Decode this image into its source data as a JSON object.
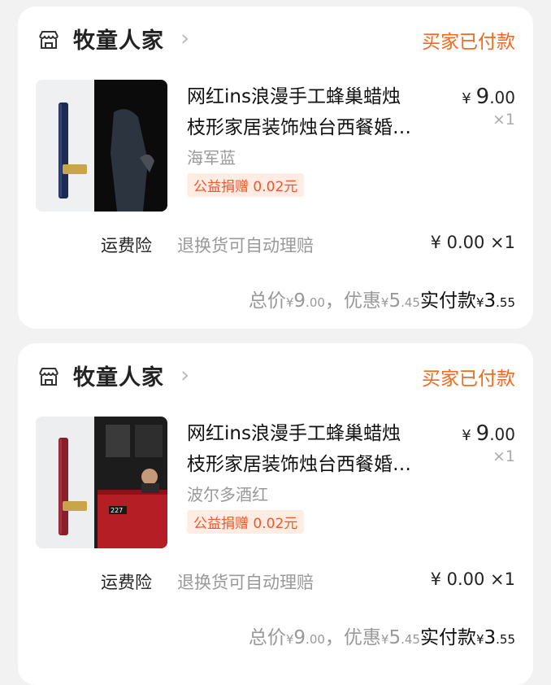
{
  "orders": [
    {
      "store": "牧童人家",
      "status": "买家已付款",
      "title_line1": "网红ins浪漫手工蜂巢蜡烛",
      "title_line2": "枝形家居装饰烛台西餐婚…",
      "price_int": "9",
      "price_dec": ".00",
      "currency": "¥",
      "qty": "×1",
      "variant": "海军蓝",
      "charity": "公益捐赠 0.02元",
      "insurance_label": "运费险",
      "insurance_desc": "退换货可自动理赔",
      "insurance_price": "¥ 0.00 ×1",
      "total_label": "总价",
      "total_int": "9",
      "total_dec": ".00",
      "discount_label": "，优惠",
      "discount_int": "5",
      "discount_dec": ".45",
      "paid_label": "实付款",
      "paid_int": "3",
      "paid_dec": ".55",
      "candle_color": "#1d2a52"
    },
    {
      "store": "牧童人家",
      "status": "买家已付款",
      "title_line1": "网红ins浪漫手工蜂巢蜡烛",
      "title_line2": "枝形家居装饰烛台西餐婚…",
      "price_int": "9",
      "price_dec": ".00",
      "currency": "¥",
      "qty": "×1",
      "variant": "波尔多酒红",
      "charity": "公益捐赠 0.02元",
      "insurance_label": "运费险",
      "insurance_desc": "退换货可自动理赔",
      "insurance_price": "¥ 0.00 ×1",
      "total_label": "总价",
      "total_int": "9",
      "total_dec": ".00",
      "discount_label": "，优惠",
      "discount_int": "5",
      "discount_dec": ".45",
      "paid_label": "实付款",
      "paid_int": "3",
      "paid_dec": ".55",
      "candle_color": "#8a1f2c",
      "bus_number": "227"
    }
  ],
  "icons": {
    "store": "store-icon",
    "chevron": "chevron-right-icon"
  },
  "colors": {
    "accent": "#f36a1e",
    "tag_bg": "#ffece3",
    "tag_text": "#f5552b"
  }
}
